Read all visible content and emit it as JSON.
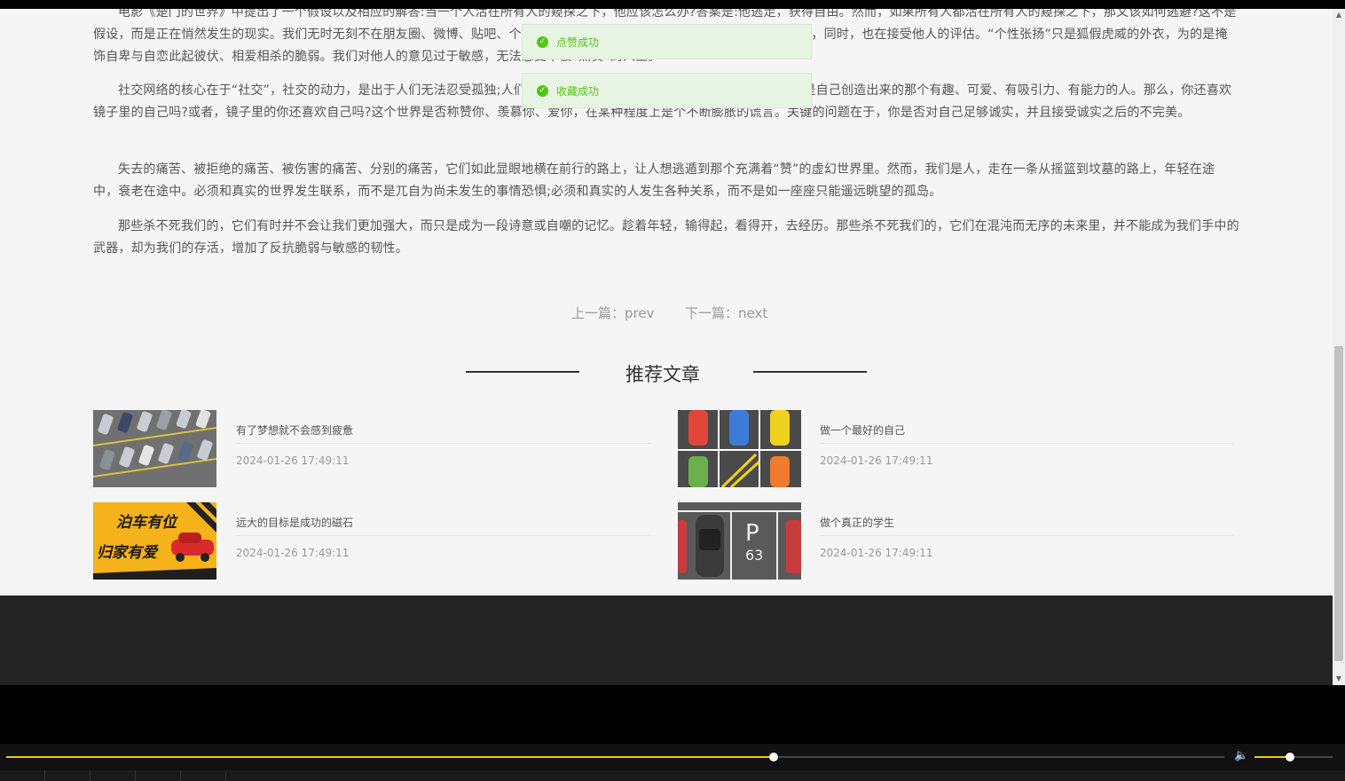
{
  "article": {
    "paragraphs": [
      "电影《楚门的世界》中提出了一个假设以及相应的解答:当一个人活在所有人的窥探之下，他应该怎么办?答案是:他逃走，获得自由。然而，如果所有人都活在所有人的窥探之下，那又该如何逃避?这不是假设，而是正在悄然发生的现实。我们无时无刻不在朋友圈、微博、贴吧、个人主页上晒自己的生活。我们无时无刻不在评估他人，同时，也在接受他人的评估。“个性张扬”只是狐假虎威的外衣，为的是掩饰自卑与自恋此起彼伏、相爱相杀的脆弱。我们对他人的意见过于敏感，无法忍受不被“点赞”的人生。",
      "社交网络的核心在于“社交”，社交的动力，是出于人们无法忍受孤独;人们……总有一天，我们要站在镜子前，发现我们并不是自己创造出来的那个有趣、可爱、有吸引力、有能力的人。那么，你还喜欢镜子里的自己吗?或者，镜子里的你还喜欢自己吗?这个世界是否称赞你、羡慕你、爱你，在某种程度上是个不断膨胀的谎言。关键的问题在于，你是否对自己足够诚实，并且接受诚实之后的不完美。",
      "失去的痛苦、被拒绝的痛苦、被伤害的痛苦、分别的痛苦，它们如此显眼地横在前行的路上，让人想逃遁到那个充满着“赞”的虚幻世界里。然而，我们是人，走在一条从摇篮到坟墓的路上，年轻在途中，衰老在途中。必须和真实的世界发生联系，而不是兀自为尚未发生的事情恐惧;必须和真实的人发生各种关系，而不是如一座座只能遥远眺望的孤岛。",
      "那些杀不死我们的，它们有时并不会让我们更加强大，而只是成为一段诗意或自嘲的记忆。趁着年轻，输得起，看得开，去经历。那些杀不死我们的，它们在混沌而无序的未来里，并不能成为我们手中的武器，却为我们的存活，增加了反抗脆弱与敏感的韧性。"
    ]
  },
  "toasts": [
    {
      "text": "点赞成功",
      "color": "#52c41a"
    },
    {
      "text": "收藏成功",
      "color": "#52c41a"
    }
  ],
  "pager": {
    "prev": "上一篇：prev",
    "next": "下一篇：next"
  },
  "recommend": {
    "title": "推荐文章",
    "items": [
      {
        "title": "有了梦想就不会感到疲惫",
        "date": "2024-01-26 17:49:11",
        "image": "parking-lot-aerial"
      },
      {
        "title": "做一个最好的自己",
        "date": "2024-01-26 17:49:11",
        "image": "parked-cars-topdown"
      },
      {
        "title": "远大的目标是成功的磁石",
        "date": "2024-01-26 17:49:11",
        "image": "parking-banner",
        "banner_line1": "泊车有位",
        "banner_line2": "归家有爱"
      },
      {
        "title": "做个真正的学生",
        "date": "2024-01-26 17:49:11",
        "image": "parking-spot-p63",
        "spot_letter": "P",
        "spot_number": "63"
      }
    ]
  },
  "player": {
    "progress": 0.63,
    "volume": 0.45,
    "accent": "#f5c400"
  }
}
